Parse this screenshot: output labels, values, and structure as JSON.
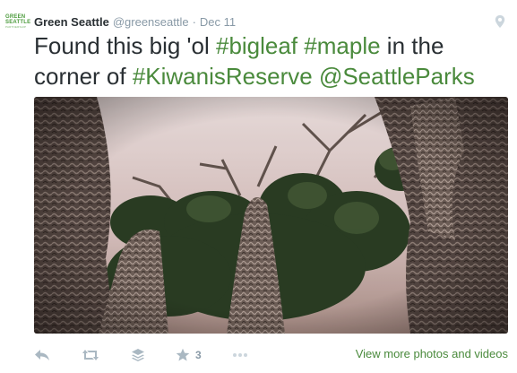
{
  "tweet": {
    "logo_line1": "GREEN",
    "logo_line2": "SEATTLE",
    "logo_tag": "PARTNERSHIP",
    "author_name": "Green Seattle",
    "handle": "@greenseattle",
    "separator": "·",
    "date": "Dec 11",
    "text": {
      "part1": "Found this big 'ol ",
      "tag1": "#bigleaf",
      "space1": " ",
      "tag2": "#maple",
      "part2": " in the corner of ",
      "tag3": "#KiwanisReserve",
      "space2": " ",
      "mention": "@SeattleParks"
    },
    "photo_description_icon": "tree-canopy-photo",
    "favorite_count": "3",
    "more_link": "View more photos and videos"
  },
  "icons": {
    "pin": "location-pin-icon",
    "reply": "reply-icon",
    "retweet": "retweet-icon",
    "buffer": "layers-icon",
    "favorite": "star-icon",
    "more": "more-dots-icon"
  },
  "colors": {
    "link": "#4a8a3c",
    "muted": "#8899a6",
    "icon": "#aab8c2",
    "text": "#292f33"
  }
}
